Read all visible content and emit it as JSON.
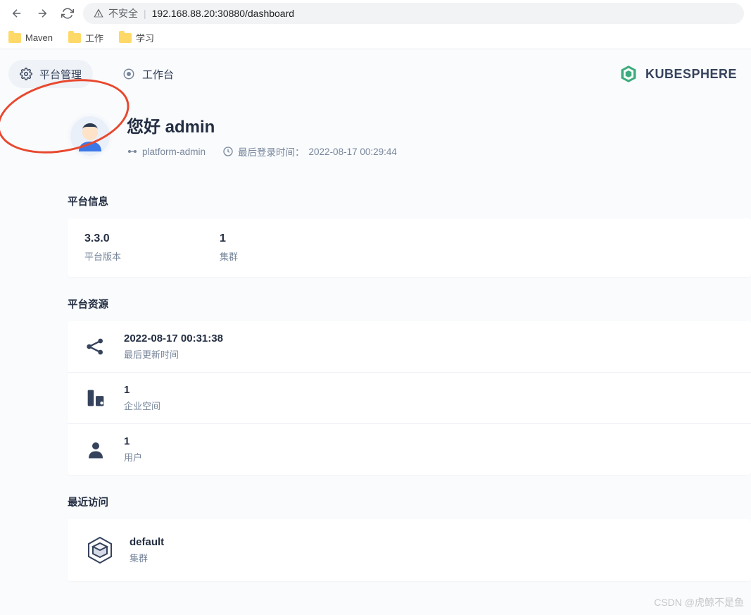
{
  "browser": {
    "security_label": "不安全",
    "url": "192.168.88.20:30880/dashboard"
  },
  "bookmarks": [
    {
      "label": "Maven"
    },
    {
      "label": "工作"
    },
    {
      "label": "学习"
    }
  ],
  "nav": {
    "platform_mgmt": "平台管理",
    "workbench": "工作台",
    "brand": "KUBESPHERE"
  },
  "greeting": {
    "title": "您好 admin",
    "role": "platform-admin",
    "last_login_label": "最后登录时间：",
    "last_login_time": "2022-08-17 00:29:44"
  },
  "platform_info": {
    "title": "平台信息",
    "version": {
      "value": "3.3.0",
      "label": "平台版本"
    },
    "clusters": {
      "value": "1",
      "label": "集群"
    }
  },
  "platform_resources": {
    "title": "平台资源",
    "updated": {
      "value": "2022-08-17 00:31:38",
      "label": "最后更新时间"
    },
    "workspaces": {
      "value": "1",
      "label": "企业空间"
    },
    "users": {
      "value": "1",
      "label": "用户"
    }
  },
  "recent": {
    "title": "最近访问",
    "item": {
      "name": "default",
      "type": "集群"
    }
  },
  "watermark": "CSDN @虎鲸不是鱼"
}
